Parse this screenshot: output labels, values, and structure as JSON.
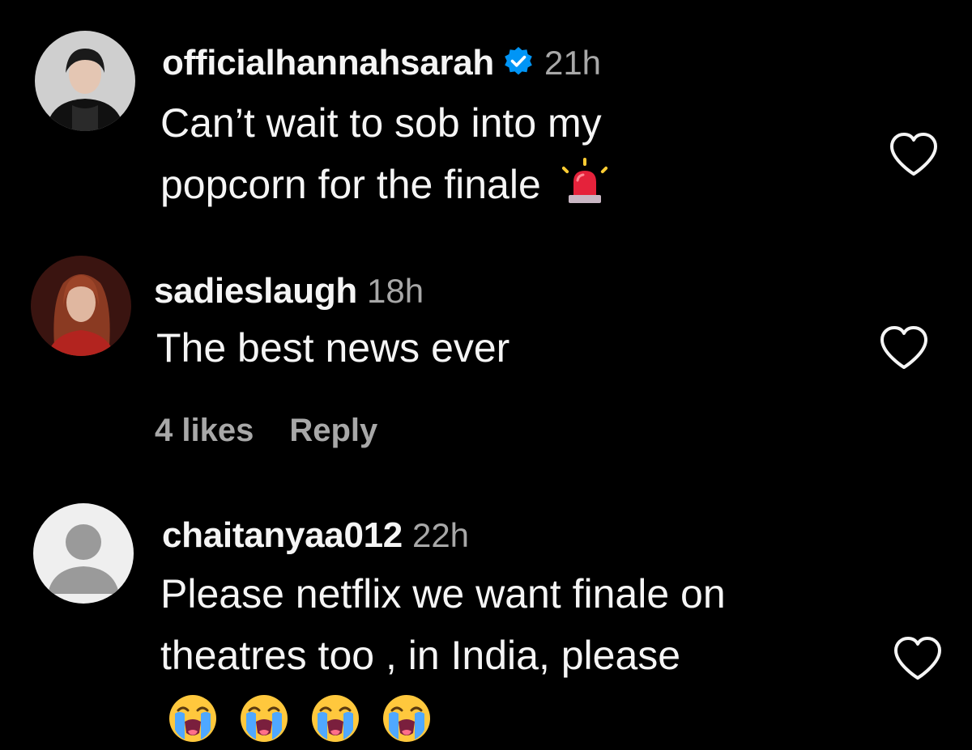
{
  "comments": [
    {
      "username": "officialhannahsarah",
      "verified": true,
      "time": "21h",
      "lines": [
        "Can’t wait to sob into my",
        "popcorn for the finale"
      ],
      "trailing_emoji": "police-car-light-emoji",
      "avatar": "profile-photo"
    },
    {
      "username": "sadieslaugh",
      "verified": false,
      "time": "18h",
      "lines": [
        "The best news ever"
      ],
      "likes_label": "4 likes",
      "reply_label": "Reply",
      "avatar": "profile-photo"
    },
    {
      "username": "chaitanyaa012",
      "verified": false,
      "time": "22h",
      "lines": [
        "Please netflix we want finale on",
        "theatres too , in India, please"
      ],
      "emoji_row": [
        "loudly-crying-face-emoji",
        "loudly-crying-face-emoji",
        "loudly-crying-face-emoji",
        "loudly-crying-face-emoji"
      ],
      "avatar": "default-avatar"
    }
  ],
  "colors": {
    "background": "#000000",
    "text": "#f5f5f5",
    "secondary": "#a8a8a8",
    "verified_blue": "#0095f6"
  },
  "icons": {
    "like": "heart-outline-icon",
    "verified": "verified-badge-icon"
  }
}
